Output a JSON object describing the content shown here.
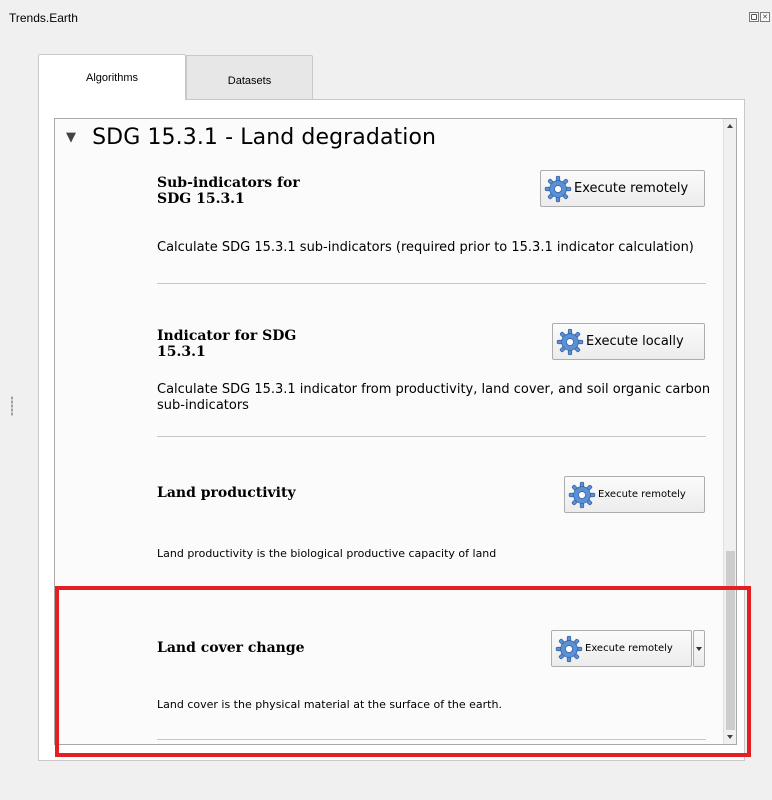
{
  "dock": {
    "title": "Trends.Earth",
    "float_icon": "float-icon",
    "close_icon": "close-icon"
  },
  "tabs": [
    {
      "label": "Algorithms",
      "active": true
    },
    {
      "label": "Datasets",
      "active": false
    }
  ],
  "section": {
    "caret_icon": "caret-down-icon",
    "title": "SDG 15.3.1 - Land degradation"
  },
  "algorithms": [
    {
      "title_line1": "Sub-indicators for",
      "title_line2": "SDG 15.3.1",
      "description": "Calculate SDG 15.3.1 sub-indicators (required prior to 15.3.1 indicator calculation)",
      "button_label": "Execute remotely",
      "button_icon": "gear-icon"
    },
    {
      "title_line1": "Indicator for SDG",
      "title_line2": "15.3.1",
      "description_line1": "Calculate SDG 15.3.1 indicator from productivity, land cover, and soil organic carbon",
      "description_line2": "sub-indicators",
      "button_label": "Execute locally",
      "button_icon": "gear-icon"
    },
    {
      "title": "Land productivity",
      "description": "Land productivity is the biological productive capacity of land",
      "button_label": "Execute remotely",
      "button_icon": "gear-icon"
    },
    {
      "title": "Land cover change",
      "description": "Land cover is the physical material at the surface of the earth.",
      "button_label": "Execute remotely",
      "button_icon": "gear-icon",
      "menu_icon": "chevron-down-icon"
    }
  ],
  "colors": {
    "highlight": "#e31e24",
    "gear": "#5b8fd6"
  }
}
